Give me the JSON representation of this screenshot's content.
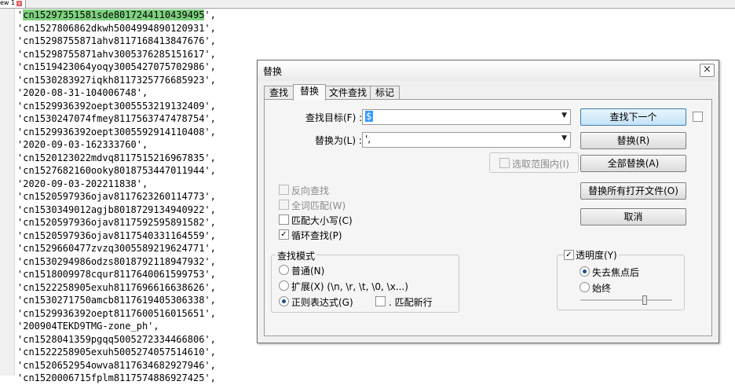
{
  "editor": {
    "tab_label": "ew 1",
    "lines": [
      "'cn15297351581sde8017244110439495',",
      "'cn1527806862dkwh5004994890120931',",
      "'cn15298755871ahv8117168413847676',",
      "'cn15298755871ahv3005376285151617',",
      "'cn1519423064yoqy3005427075702986',",
      "'cn1530283927iqkh8117325776685923',",
      "'2020-08-31-104006748',",
      "'cn1529936392oept3005553219132409',",
      "'cn1530247074fmey8117563747478754',",
      "'cn1529936392oept3005592914110408',",
      "'2020-09-03-162333760',",
      "'cn1520123022mdvq8117515216967835',",
      "'cn1527682160ooky8018753447011944',",
      "'2020-09-03-202211838',",
      "'cn1520597936ojav8117623260114773',",
      "'cn1530349012agjb8018729134940922',",
      "'cn1520597936ojav8117592595891582',",
      "'cn1520597936ojav8117540331164559',",
      "'cn1529660477zvzq3005589219624771',",
      "'cn1530294986odzs8018792118947932',",
      "'cn1518009978cqur8117640061599753',",
      "'cn1522258905exuh8117696616638626',",
      "'cn1530271750amcb8117619405306338',",
      "'cn1529936392oept8117600516015651',",
      "'200904TEKD9TMG-zone_ph',",
      "'cn1528041359pgqq5005272334466806',",
      "'cn1522258905exuh5005274057514610',",
      "'cn1520652954owva8117634682927946',",
      "'cn1520006715fplm8117574886927425',"
    ],
    "highlight_text": "cn15297351581sde8017244110439495",
    "highlight_color": "#7fd27f"
  },
  "dialog": {
    "title": "替换",
    "close_glyph": "×",
    "tabs": [
      "查找",
      "替换",
      "文件查找",
      "标记"
    ],
    "find_label": "查找目标(F) :",
    "find_value": "$",
    "replace_label": "替换为(L) :",
    "replace_value": "',",
    "in_selection_label": "选取范围内(I)",
    "find_next_button": "查找下一个",
    "replace_button": "替换(R)",
    "replace_all_button": "全部替换(A)",
    "replace_all_open_button": "替换所有打开文件(O)",
    "cancel_button": "取消",
    "options": {
      "backward": "反向查找",
      "whole_word": "全词匹配(W)",
      "match_case": "匹配大小写(C)",
      "wrap_around": "循环查找(P)",
      "wrap_around_checked": true
    },
    "search_mode": {
      "title": "查找模式",
      "normal": "普通(N)",
      "extended": "扩展(X) (\\n, \\r, \\t, \\0, \\x...)",
      "regex": "正则表达式(G)",
      "dot_newline": ". 匹配新行",
      "selected": "regex"
    },
    "transparency": {
      "label": "透明度(Y)",
      "checked": true,
      "on_lose_focus": "失去焦点后",
      "always": "始终",
      "selected": "on_lose_focus",
      "level": 0.7
    }
  }
}
